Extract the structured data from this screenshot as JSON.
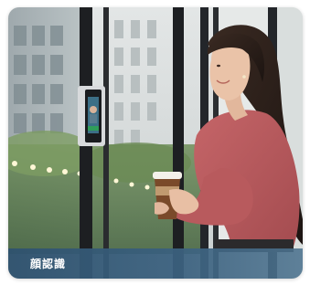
{
  "card": {
    "caption": "顔認識",
    "image_subject": "woman-using-face-recognition-terminal"
  },
  "colors": {
    "caption_bar": "#2f526e",
    "caption_text": "#ffffff",
    "blouse": "#b7585b",
    "hair": "#2a1d18",
    "cup": "#7a4a2a"
  }
}
